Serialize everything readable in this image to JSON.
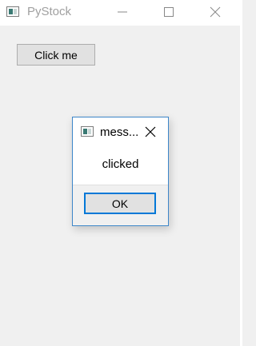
{
  "window": {
    "title": "PyStock",
    "icon": "app-window-icon"
  },
  "main": {
    "click_button_label": "Click me"
  },
  "dialog": {
    "title": "mess...",
    "message": "clicked",
    "ok_label": "OK"
  },
  "colors": {
    "accent": "#0078d7",
    "dialog_border": "#3d86c9",
    "title_inactive": "#a0a0a0"
  }
}
